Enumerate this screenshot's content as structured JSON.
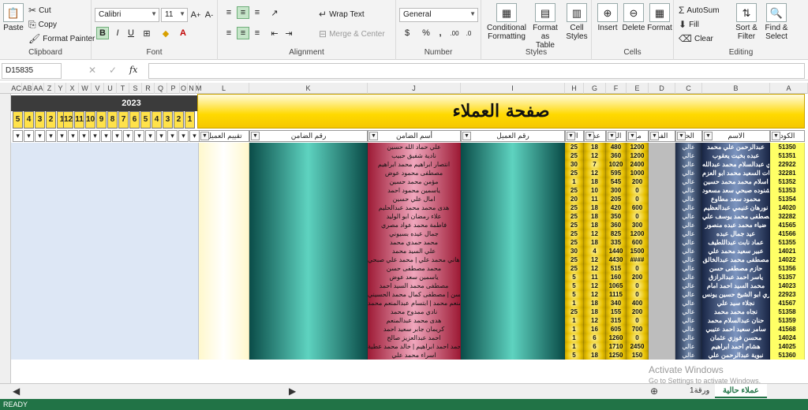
{
  "ribbon": {
    "clipboard": {
      "paste": "Paste",
      "cut": "Cut",
      "copy": "Copy",
      "format_painter": "Format Painter",
      "label": "Clipboard"
    },
    "font": {
      "name": "Calibri",
      "size": "11",
      "bold": "B",
      "italic": "I",
      "underline": "U",
      "color_letter": "A",
      "label": "Font"
    },
    "alignment": {
      "wrap": "Wrap Text",
      "merge": "Merge & Center",
      "label": "Alignment"
    },
    "number": {
      "format": "General",
      "currency": "$",
      "percent": "%",
      "comma": ",",
      "label": "Number"
    },
    "styles": {
      "conditional": "Conditional\nFormatting",
      "format_table": "Format as\nTable",
      "cell_styles": "Cell\nStyles",
      "label": "Styles"
    },
    "cells": {
      "insert": "Insert",
      "delete": "Delete",
      "format": "Format",
      "label": "Cells"
    },
    "editing": {
      "autosum": "AutoSum",
      "fill": "Fill",
      "clear": "Clear",
      "sort": "Sort &\nFilter",
      "find": "Find &\nSelect",
      "label": "Editing"
    }
  },
  "formula_bar": {
    "name_box": "D15835",
    "fx": "fx"
  },
  "columns": [
    "AC",
    "AB",
    "AA",
    "Z",
    "Y",
    "X",
    "W",
    "V",
    "U",
    "T",
    "S",
    "R",
    "Q",
    "P",
    "O",
    "N",
    "M",
    "L",
    "K",
    "J",
    "I",
    "H",
    "G",
    "F",
    "E",
    "D",
    "C",
    "B",
    "A"
  ],
  "sheet": {
    "title": "صفحة العملاء",
    "year": "2023",
    "months_right": [
      "1",
      "2",
      "3",
      "4",
      "5",
      "6",
      "7",
      "8",
      "9",
      "10",
      "11",
      "12"
    ],
    "months_left": [
      "1",
      "2",
      "3",
      "4",
      "5"
    ],
    "headers": {
      "code": "الكود",
      "name": "الاسم",
      "status": "الحا",
      "d": "الفر",
      "total": "مة",
      "e": "الق",
      "f": "عدد",
      "g": "ال",
      "client_num": "رقم العميل",
      "guarantor": "أسم الضامن",
      "guarantor_num": "رقم الضامن",
      "rating": "تقييم العميل"
    },
    "rows": [
      {
        "code": "51350",
        "name": "عبدالرحمن علي محمد",
        "status": "عالي",
        "total": "1200",
        "e": "480",
        "f": "18",
        "g": "25",
        "guarantor": "علي حماد الله حسين"
      },
      {
        "code": "51351",
        "name": "عبده بخيت يعقوب",
        "status": "عالي",
        "total": "1200",
        "e": "360",
        "f": "12",
        "g": "25",
        "guarantor": "نادية شفيق حبيب"
      },
      {
        "code": "22922",
        "name": "شيري عبدالسلام محمد عبدالله",
        "status": "عالي",
        "total": "2400",
        "e": "1020",
        "f": "7",
        "g": "30",
        "guarantor": "انتصار ابراهيم محمد ابراهيم"
      },
      {
        "code": "32281",
        "name": "نعمات السعيد محمد ابو العزم",
        "status": "عالي",
        "total": "1000",
        "e": "595",
        "f": "12",
        "g": "25",
        "guarantor": "مصطفى محمود عوض"
      },
      {
        "code": "51352",
        "name": "اسلام محمد محمد حسين",
        "status": "عالي",
        "total": "200",
        "e": "545",
        "f": "18",
        "g": "1",
        "guarantor": "مؤمن محمد حسين"
      },
      {
        "code": "51353",
        "name": "شنوده صبحي سعد مسعود",
        "status": "عالي",
        "total": "0",
        "e": "300",
        "f": "10",
        "g": "25",
        "guarantor": "ياسمين محمود احمد"
      },
      {
        "code": "51354",
        "name": "محمود سعد مطاوع",
        "status": "عالي",
        "total": "0",
        "e": "205",
        "f": "11",
        "g": "20",
        "guarantor": "امال علي حسين"
      },
      {
        "code": "14020",
        "name": "نورهان غنيمي عبدالعظيم",
        "status": "عالي",
        "total": "600",
        "e": "420",
        "f": "18",
        "g": "25",
        "guarantor": "هدى محمد محمد عبدالحليم"
      },
      {
        "code": "32282",
        "name": "مصطفى محمد يوسف علي",
        "status": "عالي",
        "total": "0",
        "e": "350",
        "f": "18",
        "g": "25",
        "guarantor": "علاء رمضان ابو الوليد"
      },
      {
        "code": "41565",
        "name": "ضياء محمد عبده منصور",
        "status": "عالي",
        "total": "300",
        "e": "360",
        "f": "18",
        "g": "25",
        "guarantor": "فاطمة محمد عواد مصري"
      },
      {
        "code": "41566",
        "name": "عيد جمال عبده",
        "status": "عالي",
        "total": "1200",
        "e": "825",
        "f": "12",
        "g": "25",
        "guarantor": "جمال عيده بسيوني"
      },
      {
        "code": "51355",
        "name": "عماد نابت عبداللطيف",
        "status": "عالي",
        "total": "600",
        "e": "335",
        "f": "18",
        "g": "25",
        "guarantor": "محمد حمدي محمد"
      },
      {
        "code": "14021",
        "name": "عبير سعيد محمد علي",
        "status": "عالي",
        "total": "1500",
        "e": "1440",
        "f": "4",
        "g": "30",
        "guarantor": "علي السيد محمد"
      },
      {
        "code": "14022",
        "name": "مصطفى محمد عبدالخالق",
        "status": "عالي",
        "total": "####",
        "e": "4430",
        "f": "12",
        "g": "25",
        "guarantor": "هدى حسين حامد | هاني محمد علي | محمد علي صبحي"
      },
      {
        "code": "51356",
        "name": "حازم مصطفى حسن",
        "status": "عالي",
        "total": "0",
        "e": "515",
        "f": "12",
        "g": "25",
        "guarantor": "محمد مصطفى حسن"
      },
      {
        "code": "51357",
        "name": "ياسر احمد عبدالرازق",
        "status": "عالي",
        "total": "200",
        "e": "160",
        "f": "11",
        "g": "5",
        "guarantor": "ياسمين سعد عوض"
      },
      {
        "code": "14023",
        "name": "محمد السيد احمد امام",
        "status": "عالي",
        "total": "0",
        "e": "1065",
        "f": "12",
        "g": "5",
        "guarantor": "مصطفى محمد السيد احمد"
      },
      {
        "code": "22923",
        "name": "شيري ابو الشيخ حسين يونس",
        "status": "عالي",
        "total": "0",
        "e": "1115",
        "f": "12",
        "g": "5",
        "guarantor": "اشرف السيد محمد حسن | مصطفى كمال محمد الحسيني"
      },
      {
        "code": "41567",
        "name": "نجلاء سيد علي",
        "status": "عالي",
        "total": "400",
        "e": "340",
        "f": "18",
        "g": "1",
        "guarantor": "مروة عبدالمنعم محمد | ابتسام عبدالمنعم محمد"
      },
      {
        "code": "51358",
        "name": "نجاه محمد محمد",
        "status": "عالي",
        "total": "200",
        "e": "155",
        "f": "18",
        "g": "25",
        "guarantor": "نادي ممدوح محمد"
      },
      {
        "code": "51359",
        "name": "حنان عبدالسلام محمد",
        "status": "عالي",
        "total": "0",
        "e": "315",
        "f": "12",
        "g": "1",
        "guarantor": "هدى محمد عبدالمنعم"
      },
      {
        "code": "41568",
        "name": "سامر سعيد احمد عتيبي",
        "status": "عالي",
        "total": "700",
        "e": "605",
        "f": "16",
        "g": "1",
        "guarantor": "كريمان جابر سعيد احمد"
      },
      {
        "code": "14024",
        "name": "محسن فوزي عثمان",
        "status": "عالي",
        "total": "0",
        "e": "1260",
        "f": "6",
        "g": "1",
        "guarantor": "احمد عبدالعزيز صالح"
      },
      {
        "code": "14025",
        "name": "هشام احمد ابراهيم",
        "status": "عالي",
        "total": "2450",
        "e": "1710",
        "f": "6",
        "g": "1",
        "guarantor": "محمد احمد ابراهيم | خالد محمد عطية"
      },
      {
        "code": "51360",
        "name": "نبوية عبدالرحمن علي",
        "status": "عالي",
        "total": "150",
        "e": "1250",
        "f": "18",
        "g": "5",
        "guarantor": "اسراء محمد علي"
      }
    ]
  },
  "tabs": [
    "عملاء حالية",
    "ورقة1"
  ],
  "status": "READY",
  "watermark": {
    "line1": "Activate Windows",
    "line2": "Go to Settings to activate Windows."
  }
}
